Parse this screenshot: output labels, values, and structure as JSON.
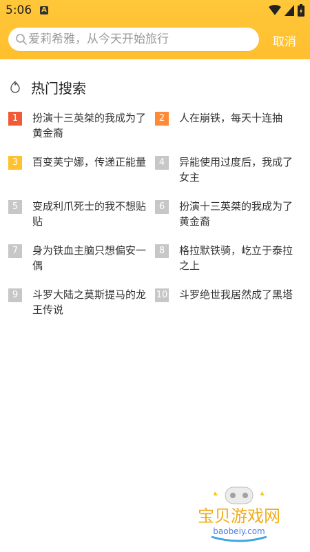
{
  "status_bar": {
    "time": "5:06",
    "notification_badge": "A"
  },
  "search": {
    "placeholder": "爱莉希雅，从今天开始旅行",
    "cancel_label": "取消"
  },
  "hot": {
    "title": "热门搜索",
    "items": [
      {
        "rank": "1",
        "label": "扮演十三英桀的我成为了黄金裔",
        "color": "#f15a36"
      },
      {
        "rank": "2",
        "label": "人在崩铁，每天十连抽",
        "color": "#ff8a33"
      },
      {
        "rank": "3",
        "label": "百变芙宁娜，传递正能量",
        "color": "#ffc12e"
      },
      {
        "rank": "4",
        "label": "异能使用过度后，我成了女主",
        "color": "#c7c7c7"
      },
      {
        "rank": "5",
        "label": "变成利爪死士的我不想贴贴",
        "color": "#c7c7c7"
      },
      {
        "rank": "6",
        "label": "扮演十三英桀的我成为了黄金裔",
        "color": "#c7c7c7"
      },
      {
        "rank": "7",
        "label": "身为铁血主脑只想偏安一偶",
        "color": "#c7c7c7"
      },
      {
        "rank": "8",
        "label": "格拉默铁骑，屹立于泰拉之上",
        "color": "#c7c7c7"
      },
      {
        "rank": "9",
        "label": "斗罗大陆之莫斯提马的龙王传说",
        "color": "#c7c7c7"
      },
      {
        "rank": "10",
        "label": "斗罗绝世我居然成了黑塔",
        "color": "#c7c7c7"
      }
    ]
  },
  "watermark": {
    "brand": "宝贝游戏网",
    "domain": "baobeiy.com"
  },
  "colors": {
    "accent": "#ffc73a",
    "top3": [
      "#f15a36",
      "#ff8a33",
      "#ffc12e"
    ],
    "rank_default": "#c7c7c7"
  }
}
